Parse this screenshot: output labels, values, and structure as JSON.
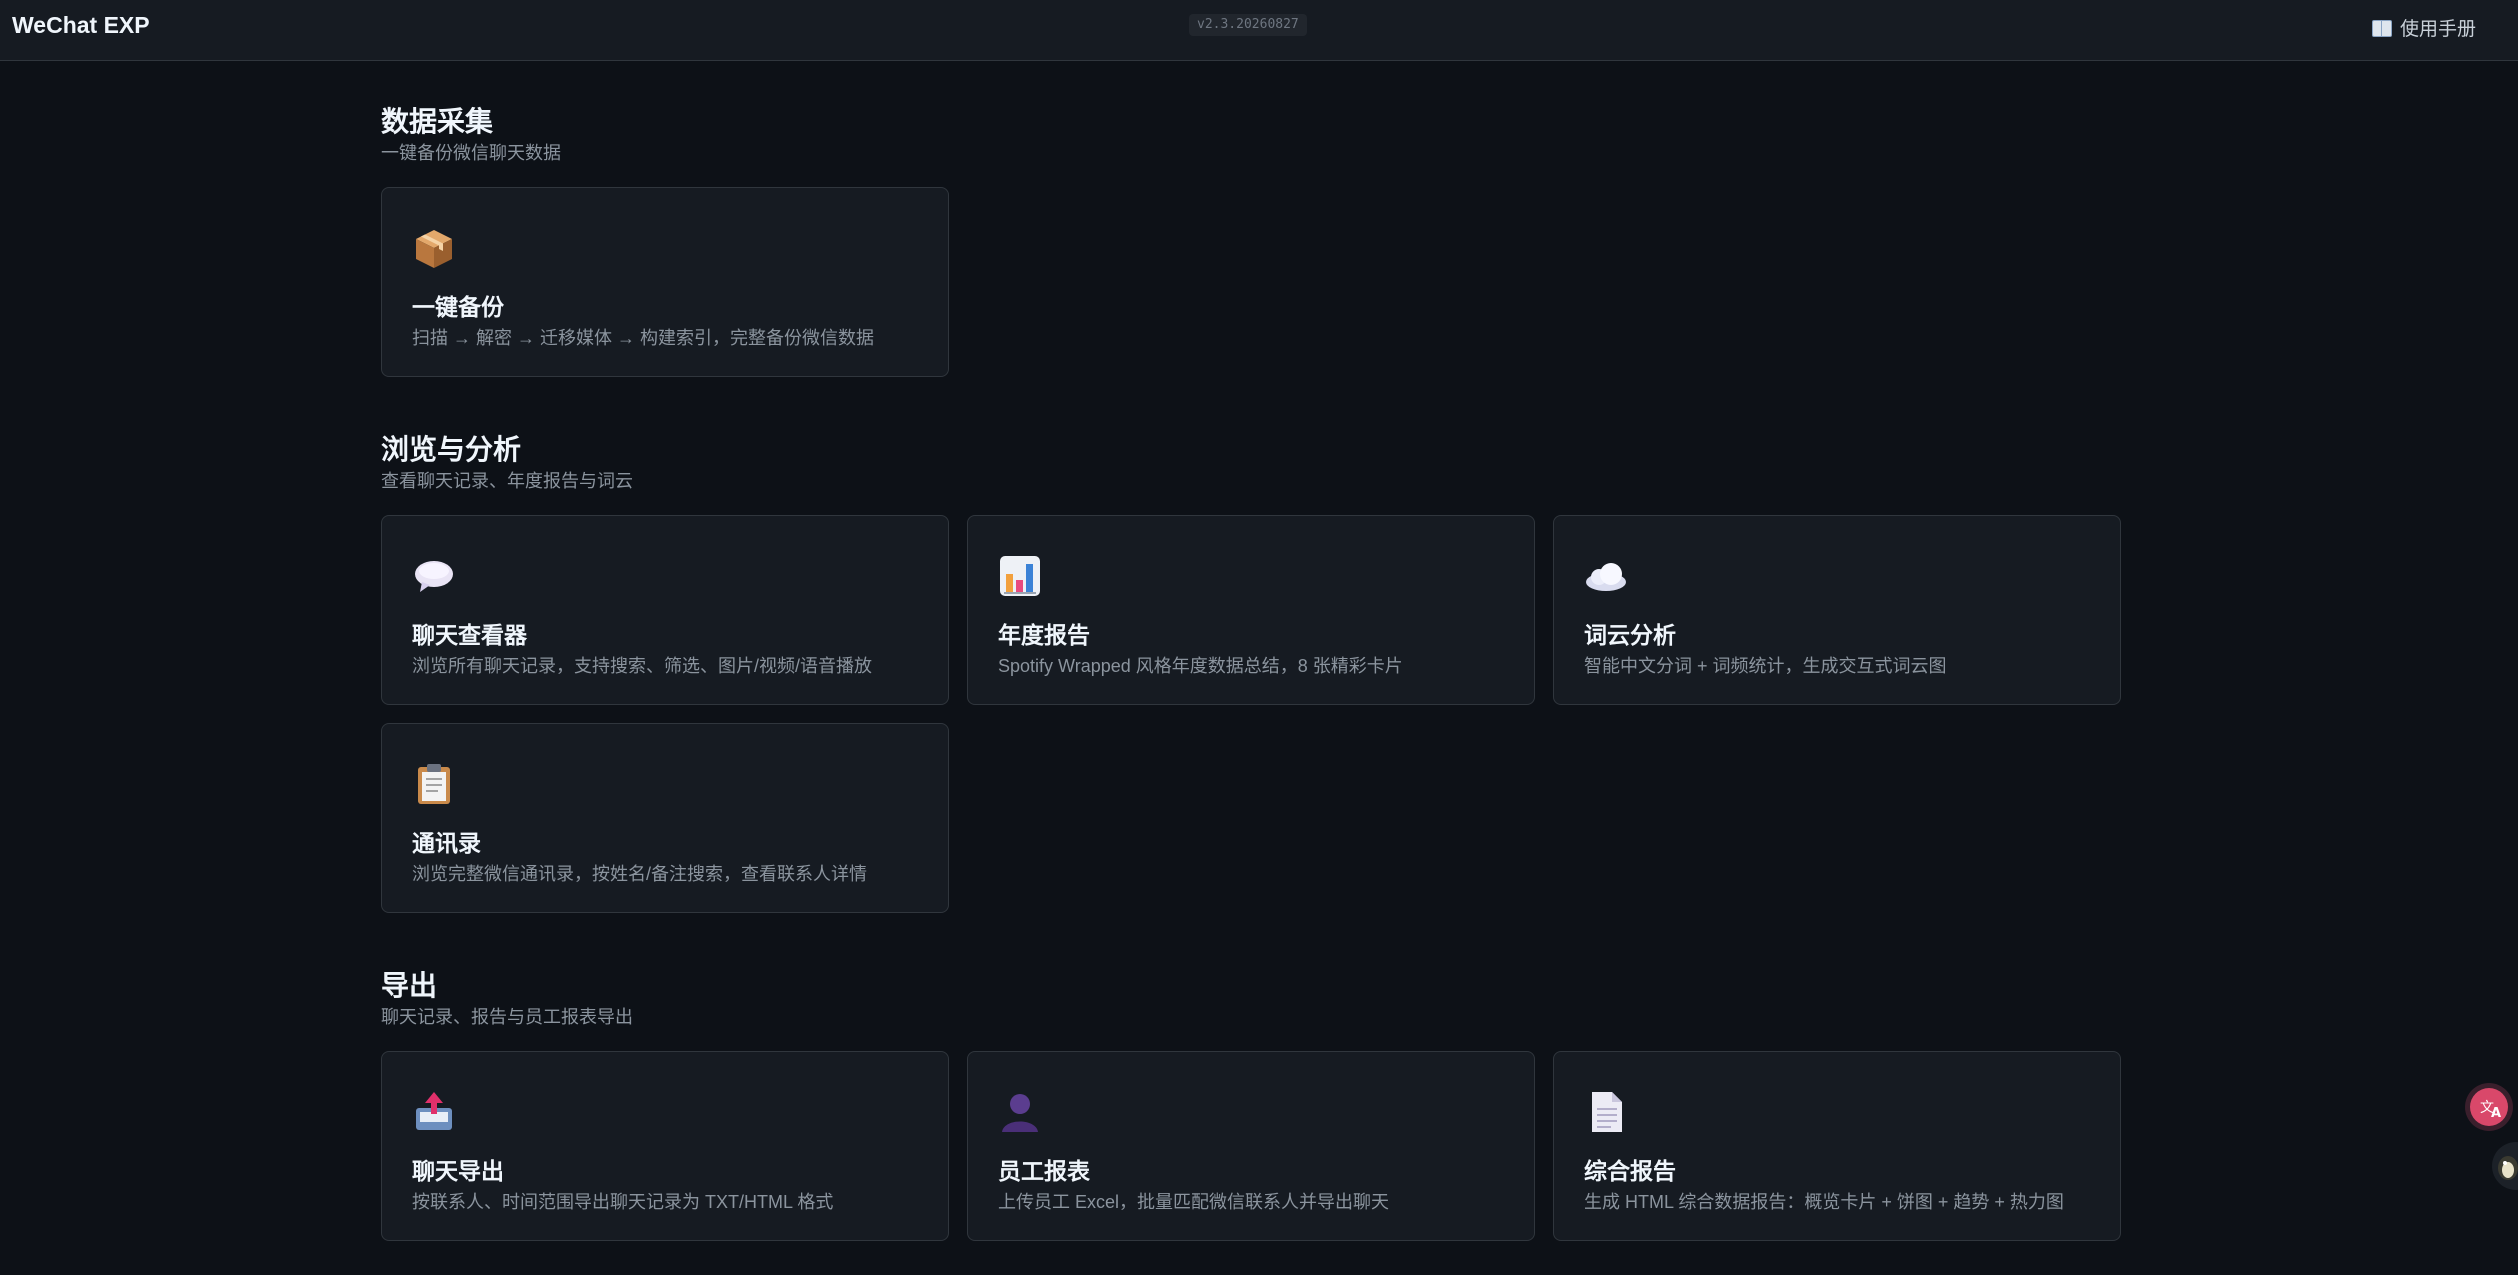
{
  "header": {
    "app_title": "WeChat EXP",
    "version": "v2.3.20260827",
    "manual_label": "使用手册",
    "manual_icon": "book-icon"
  },
  "sections": [
    {
      "title": "数据采集",
      "subtitle": "一键备份微信聊天数据",
      "cards": [
        {
          "title": "一键备份",
          "desc": "扫描 → 解密 → 迁移媒体 → 构建索引，完整备份微信数据",
          "icon": "package-icon"
        }
      ]
    },
    {
      "title": "浏览与分析",
      "subtitle": "查看聊天记录、年度报告与词云",
      "cards": [
        {
          "title": "聊天查看器",
          "desc": "浏览所有聊天记录，支持搜索、筛选、图片/视频/语音播放",
          "icon": "speech-bubble-icon"
        },
        {
          "title": "年度报告",
          "desc": "Spotify Wrapped 风格年度数据总结，8 张精彩卡片",
          "icon": "bar-chart-icon"
        },
        {
          "title": "词云分析",
          "desc": "智能中文分词 + 词频统计，生成交互式词云图",
          "icon": "cloud-icon"
        },
        {
          "title": "通讯录",
          "desc": "浏览完整微信通讯录，按姓名/备注搜索，查看联系人详情",
          "icon": "clipboard-icon"
        }
      ]
    },
    {
      "title": "导出",
      "subtitle": "聊天记录、报告与员工报表导出",
      "cards": [
        {
          "title": "聊天导出",
          "desc": "按联系人、时间范围导出聊天记录为 TXT/HTML 格式",
          "icon": "outbox-tray-icon"
        },
        {
          "title": "员工报表",
          "desc": "上传员工 Excel，批量匹配微信联系人并导出聊天",
          "icon": "person-silhouette-icon"
        },
        {
          "title": "综合报告",
          "desc": "生成 HTML 综合数据报告：概览卡片 + 饼图 + 趋势 + 热力图",
          "icon": "document-icon"
        }
      ]
    }
  ],
  "floating": {
    "translate_icon": "translate-icon",
    "assistant_icon": "mascot-icon"
  }
}
